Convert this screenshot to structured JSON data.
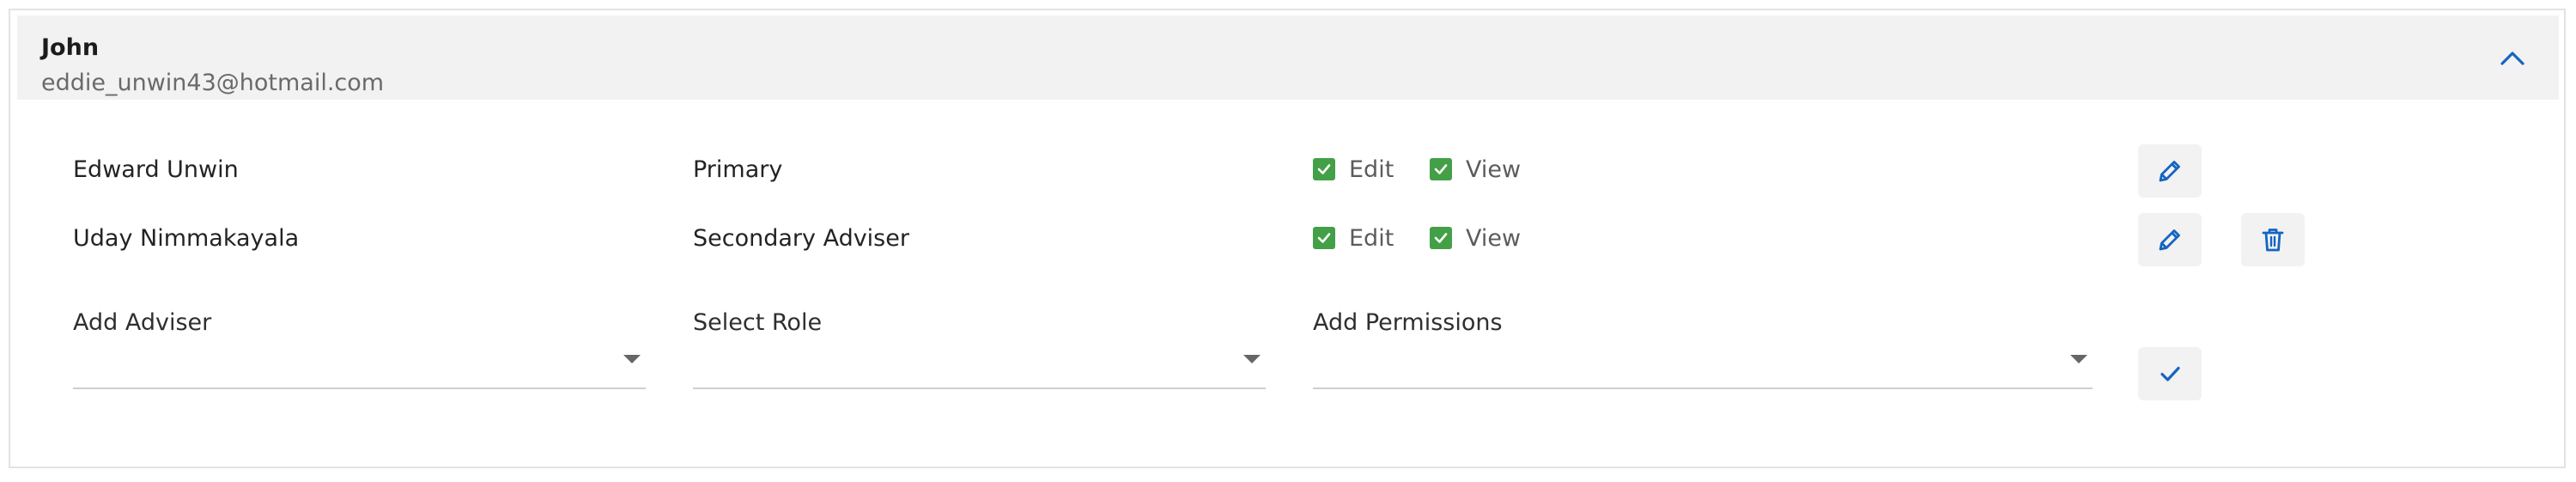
{
  "header": {
    "name": "John",
    "email": "eddie_unwin43@hotmail.com"
  },
  "advisers": [
    {
      "name": "Edward Unwin",
      "role": "Primary",
      "permissions": [
        {
          "label": "Edit",
          "checked": true
        },
        {
          "label": "View",
          "checked": true
        }
      ]
    },
    {
      "name": "Uday Nimmakayala",
      "role": "Secondary Adviser",
      "permissions": [
        {
          "label": "Edit",
          "checked": true
        },
        {
          "label": "View",
          "checked": true
        }
      ]
    }
  ],
  "add_row": {
    "adviser_label": "Add Adviser",
    "role_label": "Select Role",
    "permissions_label": "Add Permissions"
  },
  "colors": {
    "accent": "#1565c0",
    "checkbox": "#43a047",
    "header_bg": "#f2f2f2"
  },
  "icons": {
    "collapse": "chevron-up-icon",
    "edit": "pencil-icon",
    "delete": "trash-icon",
    "confirm": "check-icon"
  }
}
